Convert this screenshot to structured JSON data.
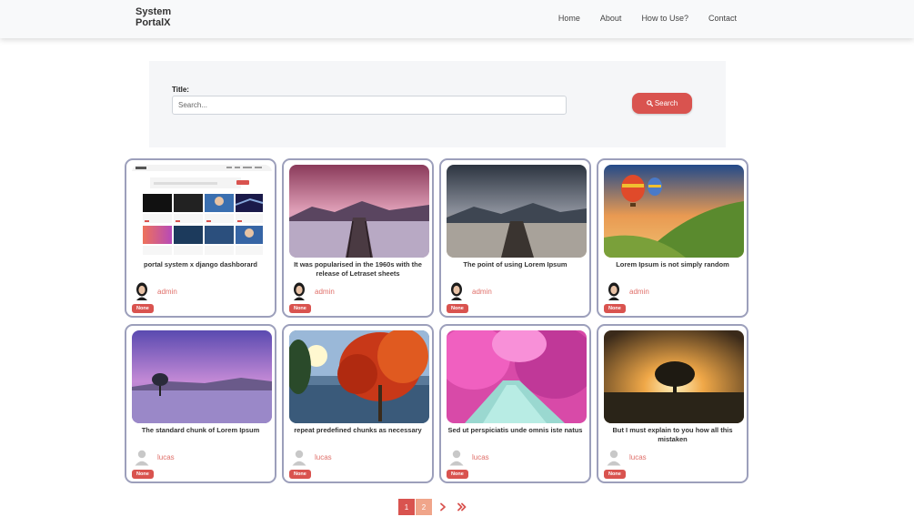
{
  "navbar": {
    "brand_line1": "System",
    "brand_line2": "PortalX",
    "links": [
      "Home",
      "About",
      "How to Use?",
      "Contact"
    ]
  },
  "search": {
    "label": "Title:",
    "placeholder": "Search...",
    "button_label": "Search"
  },
  "colors": {
    "accent": "#d9534f",
    "author": "#e0706a",
    "card_border": "#9c9fbb",
    "page_inactive": "#f0a58a"
  },
  "cards": [
    {
      "title": "portal system x django dashborard",
      "author": "admin",
      "badge": "None",
      "image": "dashboard-screenshot"
    },
    {
      "title": "It was popularised in the 1960s with the release of Letraset sheets",
      "author": "admin",
      "badge": "None",
      "image": "pier-pink-sunset"
    },
    {
      "title": "The point of using Lorem Ipsum",
      "author": "admin",
      "badge": "None",
      "image": "pier-cloudy-lake"
    },
    {
      "title": "Lorem Ipsum is not simply random",
      "author": "admin",
      "badge": "None",
      "image": "hot-air-balloons"
    },
    {
      "title": "The standard chunk of Lorem Ipsum",
      "author": "lucas",
      "badge": "None",
      "image": "purple-lake-tree"
    },
    {
      "title": "repeat predefined chunks as necessary",
      "author": "lucas",
      "badge": "None",
      "image": "autumn-trees"
    },
    {
      "title": "Sed ut perspiciatis unde omnis iste natus",
      "author": "lucas",
      "badge": "None",
      "image": "pink-blossom-path"
    },
    {
      "title": "But I must explain to you how all this mistaken",
      "author": "lucas",
      "badge": "None",
      "image": "sunset-tree"
    }
  ],
  "pagination": {
    "pages": [
      "1",
      "2"
    ],
    "current": "1",
    "next_icon": "chevron-right-icon",
    "last_icon": "double-chevron-right-icon"
  }
}
